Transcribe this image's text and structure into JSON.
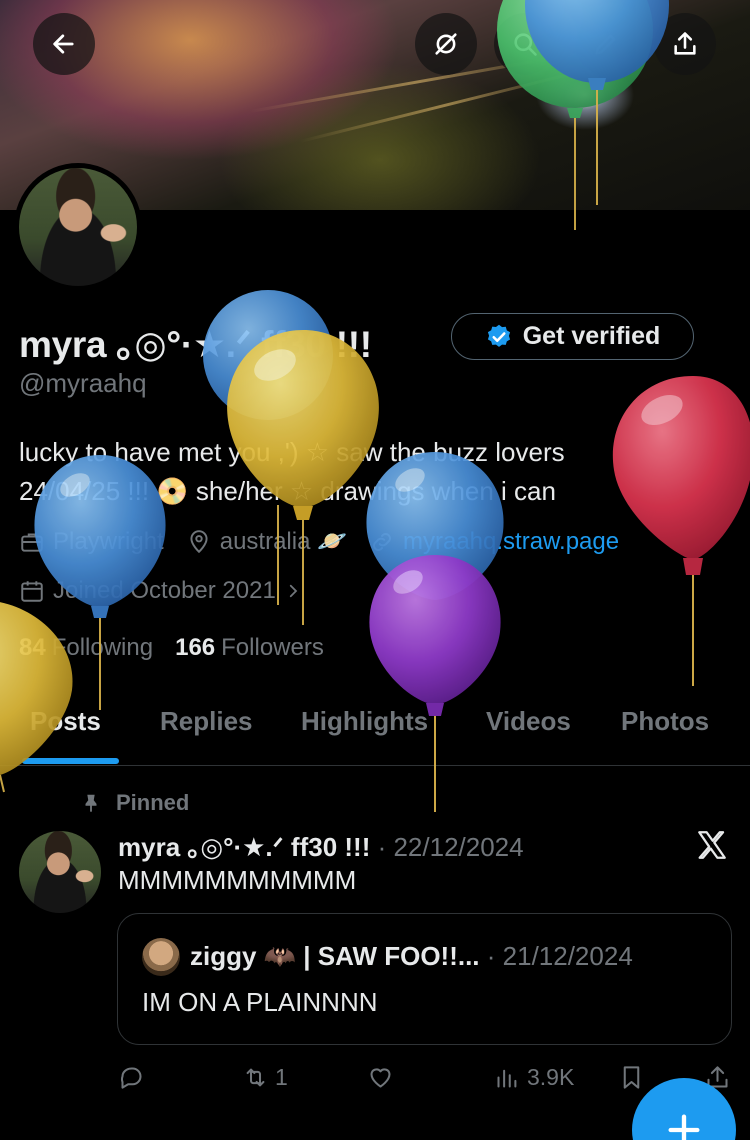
{
  "header": {
    "back_icon": "arrow-left-icon",
    "grok_icon": "grok-icon",
    "search_icon": "search-icon",
    "edit_icon": "edit-icon",
    "share_icon": "share-icon"
  },
  "profile": {
    "name": "myra ｡◎°·★.ᐟ ff30 !!!",
    "verify_label": "Get verified",
    "handle": "@myraahq",
    "bio_line1": "lucky to have met you ,') ☆ saw the buzz lovers",
    "bio_line2": "24/04/25 !!! 📀 she/her ☆ drawings when i can",
    "profession": "Playwright",
    "location": "australia 🪐",
    "website": "myraahq.straw.page",
    "joined": "Joined October 2021",
    "following_count": "84",
    "following_label": "Following",
    "followers_count": "166",
    "followers_label": "Followers"
  },
  "tabs": [
    "Posts",
    "Replies",
    "Highlights",
    "Videos",
    "Photos"
  ],
  "post": {
    "pinned_label": "Pinned",
    "name": "myra ｡◎°·★.ᐟ ff30 !!!",
    "date": "· 22/12/2024",
    "text": "MMMMMMMMMMM",
    "quote": {
      "name": "ziggy 🦇 | SAW FOO!!...",
      "date": "· 21/12/2024",
      "text": "IM ON A PLAINNNN"
    },
    "retweets": "1",
    "views": "3.9K"
  },
  "colors": {
    "accent": "#1d9bf0",
    "secondary_text": "#71767b",
    "primary_text": "#e7e9ea",
    "background": "#000000"
  }
}
